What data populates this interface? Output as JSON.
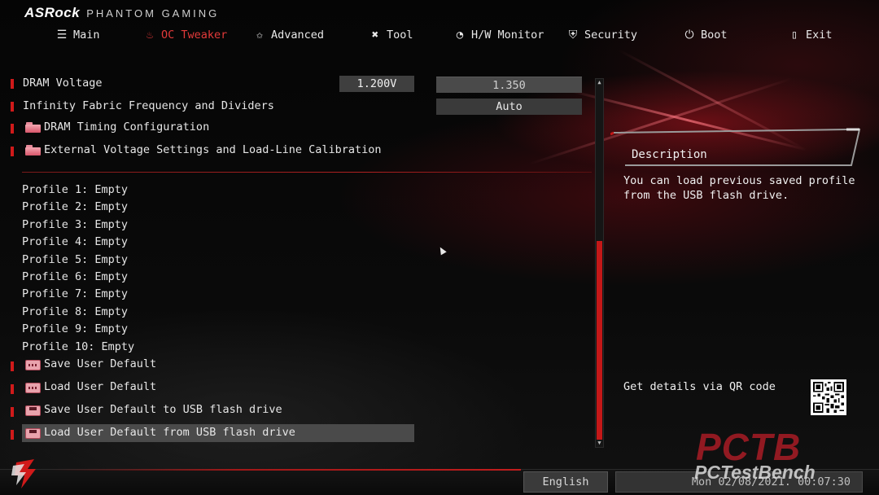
{
  "brand": {
    "logo": "ASRock",
    "subtitle": "PHANTOM GAMING"
  },
  "nav": [
    {
      "label": "Main",
      "icon": "list-icon"
    },
    {
      "label": "OC Tweaker",
      "icon": "flame-icon",
      "active": true
    },
    {
      "label": "Advanced",
      "icon": "star-icon"
    },
    {
      "label": "Tool",
      "icon": "wrench-icon"
    },
    {
      "label": "H/W Monitor",
      "icon": "gauge-icon"
    },
    {
      "label": "Security",
      "icon": "shield-icon"
    },
    {
      "label": "Boot",
      "icon": "power-icon"
    },
    {
      "label": "Exit",
      "icon": "exit-door-icon"
    }
  ],
  "settings": {
    "dram_voltage": {
      "label": "DRAM Voltage",
      "current": "1.200V",
      "value": "1.350"
    },
    "infinity_fabric": {
      "label": "Infinity Fabric Frequency and Dividers",
      "value": "Auto"
    },
    "dram_timing": {
      "label": "DRAM Timing Configuration"
    },
    "ext_voltage": {
      "label": "External Voltage Settings and Load-Line Calibration"
    }
  },
  "profiles": [
    "Profile 1: Empty",
    "Profile 2: Empty",
    "Profile 3: Empty",
    "Profile 4: Empty",
    "Profile 5: Empty",
    "Profile 6: Empty",
    "Profile 7: Empty",
    "Profile 8: Empty",
    "Profile 9: Empty",
    "Profile 10: Empty"
  ],
  "actions": [
    {
      "label": "Save User Default",
      "icon": "memory-icon"
    },
    {
      "label": "Load User Default",
      "icon": "memory-icon"
    },
    {
      "label": "Save User Default to USB flash drive",
      "icon": "floppy-disk-icon"
    },
    {
      "label": "Load User Default from USB flash drive",
      "icon": "floppy-disk-icon",
      "selected": true
    }
  ],
  "description": {
    "title": "Description",
    "text": "You can load previous saved profile\nfrom the USB flash drive.",
    "qr_label": "Get details via QR code"
  },
  "footer": {
    "language": "English",
    "datetime": "Mon 02/08/2021. 00:07:30"
  },
  "watermark": {
    "main": "PCTB",
    "sub": "PCTestBench"
  },
  "colors": {
    "accent": "#c41818",
    "active_tab": "#e23a3a",
    "highlight": "#4a4a4a"
  }
}
